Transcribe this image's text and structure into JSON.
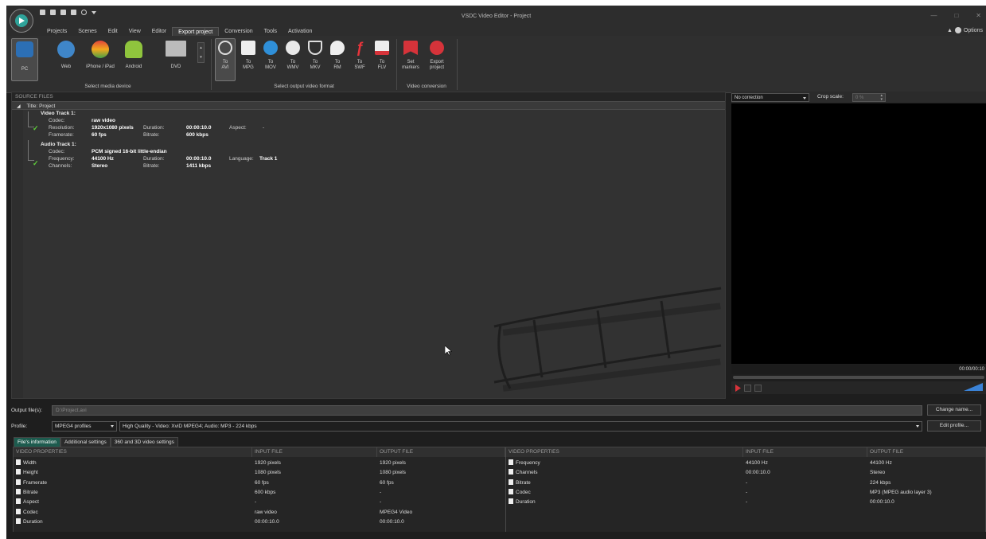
{
  "window": {
    "title": "VSDC Video Editor - Project"
  },
  "menu": {
    "items": [
      "Projects",
      "Scenes",
      "Edit",
      "View",
      "Editor",
      "Export project",
      "Conversion",
      "Tools",
      "Activation"
    ],
    "options_label": "Options"
  },
  "ribbon": {
    "devices": [
      {
        "label": "PC"
      },
      {
        "label": "Web"
      },
      {
        "label": "iPhone / iPad"
      },
      {
        "label": "Android"
      },
      {
        "label": "DVD"
      }
    ],
    "device_group_label": "Select media device",
    "formats": [
      {
        "l1": "To",
        "l2": "AVI"
      },
      {
        "l1": "To",
        "l2": "MPG"
      },
      {
        "l1": "To",
        "l2": "MOV"
      },
      {
        "l1": "To",
        "l2": "WMV"
      },
      {
        "l1": "To",
        "l2": "MKV"
      },
      {
        "l1": "To",
        "l2": "RM"
      },
      {
        "l1": "To",
        "l2": "SWF"
      },
      {
        "l1": "To",
        "l2": "FLV"
      }
    ],
    "format_group_label": "Select output video format",
    "conversion": [
      {
        "l1": "Set",
        "l2": "markers"
      },
      {
        "l1": "Export",
        "l2": "project"
      }
    ],
    "conversion_group_label": "Video conversion"
  },
  "source": {
    "header": "SOURCE FILES",
    "project_title": "Title: Project",
    "video_track": {
      "title": "Video Track 1:",
      "codec_label": "Codec:",
      "codec": "raw video",
      "resolution_label": "Resolution:",
      "resolution": "1920x1080 pixels",
      "duration_label": "Duration:",
      "duration": "00:00:10.0",
      "aspect_label": "Aspect:",
      "aspect": "-",
      "framerate_label": "Framerate:",
      "framerate": "60 fps",
      "bitrate_label": "Bitrate:",
      "bitrate": "600 kbps"
    },
    "audio_track": {
      "title": "Audio Track 1:",
      "codec_label": "Codec:",
      "codec": "PCM signed 16-bit little-endian",
      "frequency_label": "Frequency:",
      "frequency": "44100 Hz",
      "duration_label": "Duration:",
      "duration": "00:00:10.0",
      "language_label": "Language:",
      "language": "Track 1",
      "channels_label": "Channels:",
      "channels": "Stereo",
      "bitrate_label": "Bitrate:",
      "bitrate": "1411 kbps"
    }
  },
  "preview": {
    "correction": "No correction",
    "crop_label": "Crop scale:",
    "crop_value": "0 %",
    "timecode": "00:00/00:10"
  },
  "output": {
    "file_label": "Output file(s):",
    "file_value": "D:\\Project.avi",
    "change_button": "Change name...",
    "profile_label": "Profile:",
    "profile_select": "MPEG4 profiles",
    "profile_desc": "High Quality - Video: XviD MPEG4; Audio: MP3 - 224 kbps",
    "edit_button": "Edit profile..."
  },
  "tabs": [
    "File's information",
    "Additional settings",
    "360 and 3D video settings"
  ],
  "video_table": {
    "headers": [
      "VIDEO PROPERTIES",
      "INPUT FILE",
      "OUTPUT FILE"
    ],
    "rows": [
      [
        "Width",
        "1920 pixels",
        "1920 pixels"
      ],
      [
        "Height",
        "1080 pixels",
        "1080 pixels"
      ],
      [
        "Framerate",
        "60 fps",
        "60 fps"
      ],
      [
        "Bitrate",
        "600 kbps",
        "-"
      ],
      [
        "Aspect",
        "-",
        "-"
      ],
      [
        "Codec",
        "raw video",
        "MPEG4 Video"
      ],
      [
        "Duration",
        "00:00:10.0",
        "00:00:10.0"
      ]
    ]
  },
  "audio_table": {
    "headers": [
      "VIDEO PROPERTIES",
      "INPUT FILE",
      "OUTPUT FILE"
    ],
    "rows": [
      [
        "Frequency",
        "44100 Hz",
        "44100 Hz"
      ],
      [
        "Channels",
        "00:00:10.0",
        "Stereo"
      ],
      [
        "Bitrate",
        "-",
        "224 kbps"
      ],
      [
        "Codec",
        "-",
        "MP3 (MPEG audio layer 3)"
      ],
      [
        "Duration",
        "-",
        "00:00:10.0"
      ]
    ]
  },
  "colors": {
    "accent_tab": "#1d5b4e",
    "check": "#5fcf3a",
    "volume": "#3a82d6"
  }
}
